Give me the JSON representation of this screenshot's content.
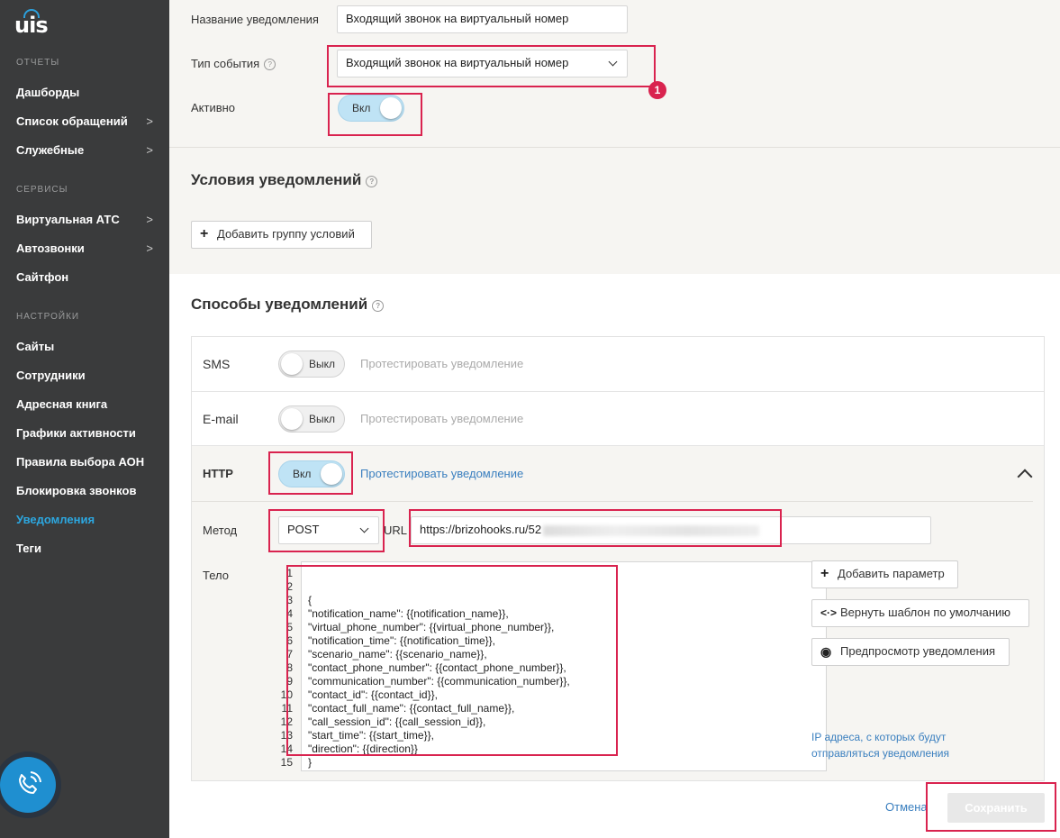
{
  "brand": {
    "logo_text": "uis",
    "accent": "#2ca7e0",
    "sidebar_bg": "#3a3b3c",
    "alert_color": "#d9234f"
  },
  "sidebar": {
    "sections": [
      {
        "title": "ОТЧЕТЫ",
        "items": [
          {
            "label": "Дашборды",
            "arrow": ""
          },
          {
            "label": "Список обращений",
            "arrow": ">"
          },
          {
            "label": "Служебные",
            "arrow": ">"
          }
        ]
      },
      {
        "title": "СЕРВИСЫ",
        "items": [
          {
            "label": "Виртуальная АТС",
            "arrow": ">"
          },
          {
            "label": "Автозвонки",
            "arrow": ">"
          },
          {
            "label": "Сайтфон",
            "arrow": ""
          }
        ]
      },
      {
        "title": "НАСТРОЙКИ",
        "items": [
          {
            "label": "Сайты",
            "arrow": ""
          },
          {
            "label": "Сотрудники",
            "arrow": ""
          },
          {
            "label": "Адресная книга",
            "arrow": ""
          },
          {
            "label": "Графики активности",
            "arrow": ""
          },
          {
            "label": "Правила выбора АОН",
            "arrow": ""
          },
          {
            "label": "Блокировка звонков",
            "arrow": ""
          },
          {
            "label": "Уведомления",
            "arrow": "",
            "active": true
          },
          {
            "label": "Теги",
            "arrow": ""
          }
        ]
      }
    ],
    "call_icon": "phone-call-icon"
  },
  "form": {
    "name_label": "Название уведомления",
    "name_value": "Входящий звонок на виртуальный номер",
    "event_label": "Тип события",
    "event_value": "Входящий звонок на виртуальный номер",
    "active_label": "Активно",
    "active_toggle": "Вкл",
    "badge": "1"
  },
  "conditions": {
    "title": "Условия уведомлений",
    "add_group_button": "Добавить группу условий"
  },
  "methods": {
    "title": "Способы уведомлений",
    "sms": {
      "label": "SMS",
      "toggle": "Выкл",
      "test": "Протестировать уведомление"
    },
    "email": {
      "label": "E-mail",
      "toggle": "Выкл",
      "test": "Протестировать уведомление"
    },
    "http": {
      "label": "HTTP",
      "toggle": "Вкл",
      "test": "Протестировать уведомление",
      "method_label": "Метод",
      "method_value": "POST",
      "url_label": "URL",
      "url_value": "https://brizohooks.ru/52",
      "body_label": "Тело",
      "line_numbers": [
        "1",
        "2",
        "3",
        "4",
        "5",
        "6",
        "7",
        "8",
        "9",
        "10",
        "11",
        "12",
        "13",
        "14",
        "15"
      ],
      "body_lines": [
        "{",
        "\"notification_name\": {{notification_name}},",
        "\"virtual_phone_number\": {{virtual_phone_number}},",
        "\"notification_time\": {{notification_time}},",
        "\"scenario_name\": {{scenario_name}},",
        "\"contact_phone_number\": {{contact_phone_number}},",
        "\"communication_number\": {{communication_number}},",
        "\"contact_id\": {{contact_id}},",
        "\"contact_full_name\": {{contact_full_name}},",
        "\"call_session_id\": {{call_session_id}},",
        "\"start_time\": {{start_time}},",
        "\"direction\": {{direction}}",
        "}",
        "",
        ""
      ],
      "add_param_button": "Добавить параметр",
      "reset_template_button": "Вернуть шаблон по умолчанию",
      "preview_button": "Предпросмотр уведомления",
      "ip_link": "IP адреса, с которых будут отправляться уведомления"
    }
  },
  "footer": {
    "cancel": "Отмена",
    "save": "Сохранить"
  }
}
